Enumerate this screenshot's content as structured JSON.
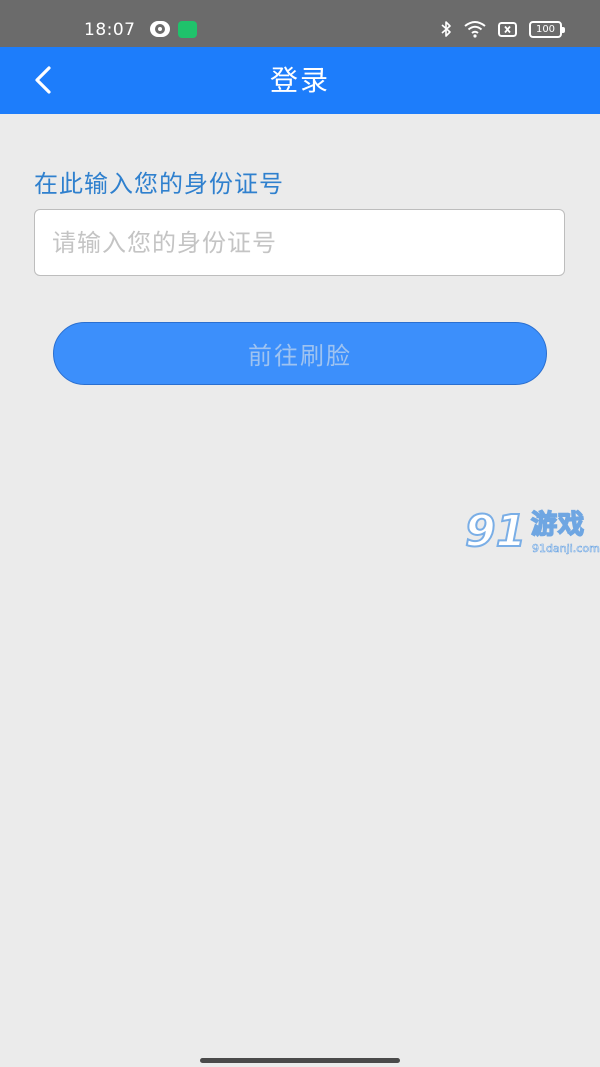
{
  "status_bar": {
    "time": "18:07",
    "notification_badge": "",
    "battery_level": "100",
    "icons": [
      "eye-icon",
      "app-notification-icon",
      "bluetooth-icon",
      "wifi-icon",
      "no-sim-icon",
      "battery-icon"
    ]
  },
  "header": {
    "title": "登录",
    "back_icon": "chevron-left-icon",
    "background_color": "#1d7dfb"
  },
  "form": {
    "label": "在此输入您的身份证号",
    "id_input": {
      "value": "",
      "placeholder": "请输入您的身份证号"
    },
    "submit_label": "前往刷脸"
  },
  "watermark": {
    "mark": "91",
    "text": "游戏",
    "domain": "91danji.com"
  },
  "colors": {
    "accent": "#1d7dfb",
    "label": "#2f80ce",
    "button": "#3c8ffb",
    "background": "#ebebeb"
  }
}
